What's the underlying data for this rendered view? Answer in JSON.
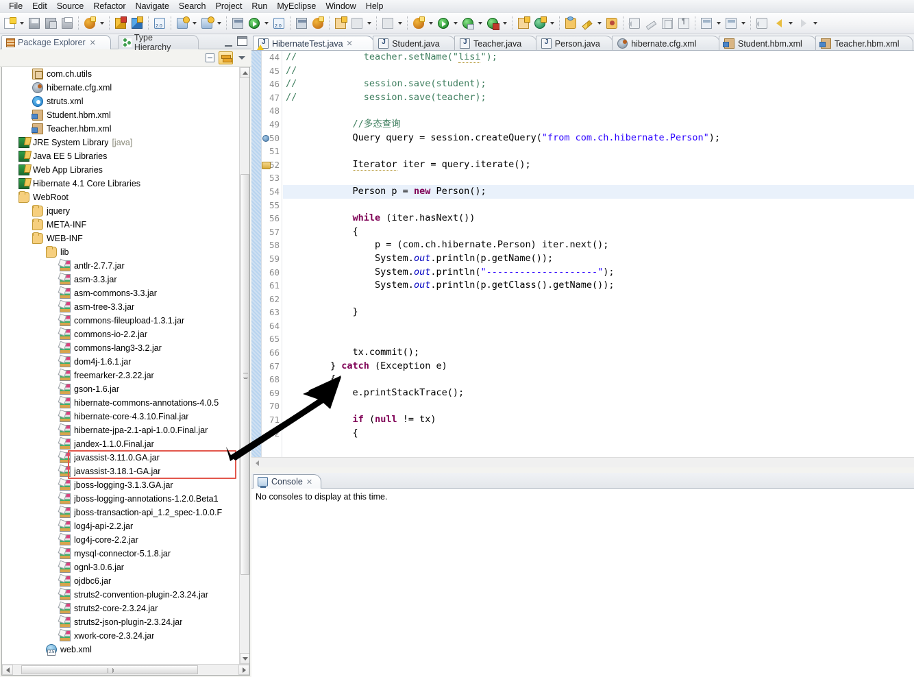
{
  "menu": {
    "items": [
      "File",
      "Edit",
      "Source",
      "Refactor",
      "Navigate",
      "Search",
      "Project",
      "Run",
      "MyEclipse",
      "Window",
      "Help"
    ]
  },
  "toolbar": {
    "groups": [
      {
        "buttons": [
          {
            "name": "new-wizard-button",
            "icon": "doc-new",
            "dropdown": true
          },
          {
            "name": "save-button",
            "icon": "save",
            "dropdown": false
          },
          {
            "name": "save-all-button",
            "icon": "saveall",
            "dropdown": false
          },
          {
            "name": "print-button",
            "icon": "print",
            "dropdown": false
          }
        ]
      },
      {
        "buttons": [
          {
            "name": "myeclipse-db-browser-button",
            "icon": "debug",
            "dropdown": true
          }
        ]
      },
      {
        "buttons": [
          {
            "name": "deploy-yellow-button",
            "icon": "cube-y",
            "dropdown": false
          },
          {
            "name": "deploy-blue-button",
            "icon": "cube-b",
            "dropdown": false
          }
        ]
      },
      {
        "buttons": [
          {
            "name": "web20-tools-button",
            "icon": "web20",
            "dropdown": false
          }
        ]
      },
      {
        "buttons": [
          {
            "name": "run-server-button",
            "icon": "runw",
            "dropdown": true
          },
          {
            "name": "stop-server-button",
            "icon": "runw",
            "dropdown": true
          }
        ]
      },
      {
        "buttons": [
          {
            "name": "open-type-button",
            "icon": "stack",
            "dropdown": false
          },
          {
            "name": "run-as-button",
            "icon": "rungreen",
            "dropdown": true
          },
          {
            "name": "web-browser-button",
            "icon": "web20",
            "dropdown": false
          }
        ]
      },
      {
        "buttons": [
          {
            "name": "open-task-button",
            "icon": "stack",
            "dropdown": false
          },
          {
            "name": "build-button",
            "icon": "debug",
            "dropdown": false
          }
        ]
      },
      {
        "buttons": [
          {
            "name": "new-java-project-button",
            "icon": "newpkg",
            "dropdown": false
          },
          {
            "name": "new-package-button",
            "icon": "gray1",
            "dropdown": true
          }
        ]
      },
      {
        "buttons": [
          {
            "name": "new-element-button",
            "icon": "gray1",
            "dropdown": true
          }
        ]
      },
      {
        "buttons": [
          {
            "name": "debug-perspective-button",
            "icon": "debug",
            "dropdown": true
          },
          {
            "name": "run-launch-button",
            "icon": "rungreen",
            "dropdown": true
          },
          {
            "name": "debug-launch-button",
            "icon": "debugbug",
            "dropdown": true
          },
          {
            "name": "profile-launch-button",
            "icon": "runcfg",
            "dropdown": true
          }
        ]
      },
      {
        "buttons": [
          {
            "name": "new-class-wizard-button",
            "icon": "newpkg",
            "dropdown": false
          },
          {
            "name": "new-annotation-button",
            "icon": "newclass",
            "dropdown": true
          }
        ]
      },
      {
        "buttons": [
          {
            "name": "open-resource-button",
            "icon": "folder-o",
            "dropdown": false
          },
          {
            "name": "edit-button",
            "icon": "pencil",
            "dropdown": true
          },
          {
            "name": "search-folder-button",
            "icon": "folder-p",
            "dropdown": false
          }
        ]
      },
      {
        "buttons": [
          {
            "name": "pin-editor-button",
            "icon": "spk",
            "dropdown": false
          },
          {
            "name": "toggle-mark-occurrences-button",
            "icon": "ruler",
            "dropdown": false
          },
          {
            "name": "show-whitespace-button",
            "icon": "gray2",
            "dropdown": false
          },
          {
            "name": "toggle-block-selection-button",
            "icon": "gray3",
            "dropdown": false
          }
        ]
      },
      {
        "buttons": [
          {
            "name": "next-annotation-button",
            "icon": "persp",
            "dropdown": true
          },
          {
            "name": "previous-annotation-button",
            "icon": "persp",
            "dropdown": true
          }
        ]
      },
      {
        "buttons": [
          {
            "name": "last-edit-location-button",
            "icon": "spk",
            "dropdown": false
          },
          {
            "name": "back-button",
            "icon": "backarr",
            "dropdown": true
          },
          {
            "name": "forward-button",
            "icon": "fwdarr",
            "dropdown": true
          }
        ]
      }
    ]
  },
  "left_panel": {
    "tabs": [
      {
        "label": "Package Explorer",
        "icon": "package-explorer-icon",
        "active": true,
        "closeable": true
      },
      {
        "label": "Type Hierarchy",
        "icon": "type-hierarchy-icon",
        "active": false,
        "closeable": false
      }
    ],
    "view_buttons": [
      {
        "name": "collapse-all-button",
        "icon": "collapse-all-icon"
      },
      {
        "name": "link-with-editor-button",
        "icon": "link-editor-icon",
        "pressed": true
      },
      {
        "name": "view-menu-button",
        "icon": "view-menu-icon"
      }
    ],
    "minimize_label": "Minimize",
    "maximize_label": "Maximize",
    "tree": [
      {
        "label": "com.ch.utils",
        "icon": "package-icon",
        "indent": 2,
        "dim": ""
      },
      {
        "label": "hibernate.cfg.xml",
        "icon": "hibernate-cfg-icon",
        "indent": 2,
        "dim": ""
      },
      {
        "label": "struts.xml",
        "icon": "struts-xml-icon",
        "indent": 2,
        "dim": ""
      },
      {
        "label": "Student.hbm.xml",
        "icon": "hbm-xml-icon",
        "indent": 2,
        "dim": ""
      },
      {
        "label": "Teacher.hbm.xml",
        "icon": "hbm-xml-icon",
        "indent": 2,
        "dim": ""
      },
      {
        "label": "JRE System Library",
        "icon": "library-icon",
        "indent": 1,
        "dim": "[java]"
      },
      {
        "label": "Java EE 5 Libraries",
        "icon": "library-icon",
        "indent": 1,
        "dim": ""
      },
      {
        "label": "Web App Libraries",
        "icon": "library-icon",
        "indent": 1,
        "dim": ""
      },
      {
        "label": "Hibernate 4.1 Core Libraries",
        "icon": "library-icon",
        "indent": 1,
        "dim": ""
      },
      {
        "label": "WebRoot",
        "icon": "folder-icon",
        "indent": 1,
        "dim": ""
      },
      {
        "label": "jquery",
        "icon": "folder-icon",
        "indent": 2,
        "dim": ""
      },
      {
        "label": "META-INF",
        "icon": "folder-icon",
        "indent": 2,
        "dim": ""
      },
      {
        "label": "WEB-INF",
        "icon": "folder-icon",
        "indent": 2,
        "dim": ""
      },
      {
        "label": "lib",
        "icon": "folder-icon",
        "indent": 3,
        "dim": ""
      },
      {
        "label": "antlr-2.7.7.jar",
        "icon": "jar-icon",
        "indent": 4,
        "dim": ""
      },
      {
        "label": "asm-3.3.jar",
        "icon": "jar-icon",
        "indent": 4,
        "dim": ""
      },
      {
        "label": "asm-commons-3.3.jar",
        "icon": "jar-icon",
        "indent": 4,
        "dim": ""
      },
      {
        "label": "asm-tree-3.3.jar",
        "icon": "jar-icon",
        "indent": 4,
        "dim": ""
      },
      {
        "label": "commons-fileupload-1.3.1.jar",
        "icon": "jar-icon",
        "indent": 4,
        "dim": ""
      },
      {
        "label": "commons-io-2.2.jar",
        "icon": "jar-icon",
        "indent": 4,
        "dim": ""
      },
      {
        "label": "commons-lang3-3.2.jar",
        "icon": "jar-icon",
        "indent": 4,
        "dim": ""
      },
      {
        "label": "dom4j-1.6.1.jar",
        "icon": "jar-icon",
        "indent": 4,
        "dim": ""
      },
      {
        "label": "freemarker-2.3.22.jar",
        "icon": "jar-icon",
        "indent": 4,
        "dim": ""
      },
      {
        "label": "gson-1.6.jar",
        "icon": "jar-icon",
        "indent": 4,
        "dim": ""
      },
      {
        "label": "hibernate-commons-annotations-4.0.5",
        "icon": "jar-icon",
        "indent": 4,
        "dim": ""
      },
      {
        "label": "hibernate-core-4.3.10.Final.jar",
        "icon": "jar-icon",
        "indent": 4,
        "dim": ""
      },
      {
        "label": "hibernate-jpa-2.1-api-1.0.0.Final.jar",
        "icon": "jar-icon",
        "indent": 4,
        "dim": ""
      },
      {
        "label": "jandex-1.1.0.Final.jar",
        "icon": "jar-icon",
        "indent": 4,
        "dim": ""
      },
      {
        "label": "javassist-3.11.0.GA.jar",
        "icon": "jar-icon",
        "indent": 4,
        "dim": "",
        "highlighted": true
      },
      {
        "label": "javassist-3.18.1-GA.jar",
        "icon": "jar-icon",
        "indent": 4,
        "dim": "",
        "highlighted": true
      },
      {
        "label": "jboss-logging-3.1.3.GA.jar",
        "icon": "jar-icon",
        "indent": 4,
        "dim": ""
      },
      {
        "label": "jboss-logging-annotations-1.2.0.Beta1",
        "icon": "jar-icon",
        "indent": 4,
        "dim": ""
      },
      {
        "label": "jboss-transaction-api_1.2_spec-1.0.0.F",
        "icon": "jar-icon",
        "indent": 4,
        "dim": ""
      },
      {
        "label": "log4j-api-2.2.jar",
        "icon": "jar-icon",
        "indent": 4,
        "dim": ""
      },
      {
        "label": "log4j-core-2.2.jar",
        "icon": "jar-icon",
        "indent": 4,
        "dim": ""
      },
      {
        "label": "mysql-connector-5.1.8.jar",
        "icon": "jar-icon",
        "indent": 4,
        "dim": ""
      },
      {
        "label": "ognl-3.0.6.jar",
        "icon": "jar-icon",
        "indent": 4,
        "dim": ""
      },
      {
        "label": "ojdbc6.jar",
        "icon": "jar-icon",
        "indent": 4,
        "dim": ""
      },
      {
        "label": "struts2-convention-plugin-2.3.24.jar",
        "icon": "jar-icon",
        "indent": 4,
        "dim": ""
      },
      {
        "label": "struts2-core-2.3.24.jar",
        "icon": "jar-icon",
        "indent": 4,
        "dim": ""
      },
      {
        "label": "struts2-json-plugin-2.3.24.jar",
        "icon": "jar-icon",
        "indent": 4,
        "dim": ""
      },
      {
        "label": "xwork-core-2.3.24.jar",
        "icon": "jar-icon",
        "indent": 4,
        "dim": ""
      },
      {
        "label": "web.xml",
        "icon": "web-xml-icon",
        "indent": 3,
        "dim": ""
      }
    ]
  },
  "editor": {
    "tabs": [
      {
        "label": "HibernateTest.java",
        "icon": "java-file-warning-icon",
        "active": true,
        "closeable": true
      },
      {
        "label": "Student.java",
        "icon": "java-file-icon",
        "active": false,
        "closeable": false
      },
      {
        "label": "Teacher.java",
        "icon": "java-file-icon",
        "active": false,
        "closeable": false
      },
      {
        "label": "Person.java",
        "icon": "java-file-icon",
        "active": false,
        "closeable": false
      },
      {
        "label": "hibernate.cfg.xml",
        "icon": "hibernate-cfg-icon",
        "active": false,
        "closeable": false
      },
      {
        "label": "Student.hbm.xml",
        "icon": "hbm-xml-icon",
        "active": false,
        "closeable": false
      },
      {
        "label": "Teacher.hbm.xml",
        "icon": "hbm-xml-icon",
        "active": false,
        "closeable": false
      }
    ],
    "first_line": 44,
    "highlight_line": 54,
    "lines": [
      {
        "n": 44,
        "html": "<span class=\"c\">//            teacher.setName(\"</span><span class=\"c u\">lisi</span><span class=\"c\">\");</span>"
      },
      {
        "n": 45,
        "html": "<span class=\"c\">//</span>"
      },
      {
        "n": 46,
        "html": "<span class=\"c\">//            session.save(student);</span>"
      },
      {
        "n": 47,
        "html": "<span class=\"c\">//            session.save(teacher);</span>"
      },
      {
        "n": 48,
        "html": ""
      },
      {
        "n": 49,
        "html": "            <span class=\"c\">//多态查询</span>"
      },
      {
        "n": 50,
        "html": "            Query query = session.createQuery(<span class=\"s\">\"from com.ch.hibernate.Person\"</span>);",
        "marker": "breakpoint"
      },
      {
        "n": 51,
        "html": ""
      },
      {
        "n": 52,
        "html": "            <span class=\"u\">Iterator</span> iter = query.iterate();",
        "marker": "quickfix"
      },
      {
        "n": 53,
        "html": ""
      },
      {
        "n": 54,
        "html": "            Person p = <span class=\"k\">new</span> Person();",
        "highlight": true
      },
      {
        "n": 55,
        "html": ""
      },
      {
        "n": 56,
        "html": "            <span class=\"k\">while</span> (iter.hasNext())"
      },
      {
        "n": 57,
        "html": "            {"
      },
      {
        "n": 58,
        "html": "                p = (com.ch.hibernate.Person) iter.next();"
      },
      {
        "n": 59,
        "html": "                System.<span class=\"f\">out</span>.println(p.getName());"
      },
      {
        "n": 60,
        "html": "                System.<span class=\"f\">out</span>.println(<span class=\"s\">\"--------------------\"</span>);"
      },
      {
        "n": 61,
        "html": "                System.<span class=\"f\">out</span>.println(p.getClass().getName());"
      },
      {
        "n": 62,
        "html": ""
      },
      {
        "n": 63,
        "html": "            }"
      },
      {
        "n": 64,
        "html": ""
      },
      {
        "n": 65,
        "html": ""
      },
      {
        "n": 66,
        "html": "            tx.commit();"
      },
      {
        "n": 67,
        "html": "        } <span class=\"k\">catch</span> (Exception e)"
      },
      {
        "n": 68,
        "html": "        {"
      },
      {
        "n": 69,
        "html": "            e.printStackTrace();"
      },
      {
        "n": 70,
        "html": ""
      },
      {
        "n": 71,
        "html": "            <span class=\"k\">if</span> (<span class=\"k\">null</span> != tx)"
      },
      {
        "n": 72,
        "html": "            {"
      }
    ]
  },
  "console": {
    "tab_label": "Console",
    "tab_icon": "console-icon",
    "empty_message": "No consoles to display at this time."
  },
  "annotation": {
    "highlight_color": "#e2574c",
    "arrow_color": "#000000",
    "arrow_label": "pointer-arrow-to-javassist-jars"
  }
}
